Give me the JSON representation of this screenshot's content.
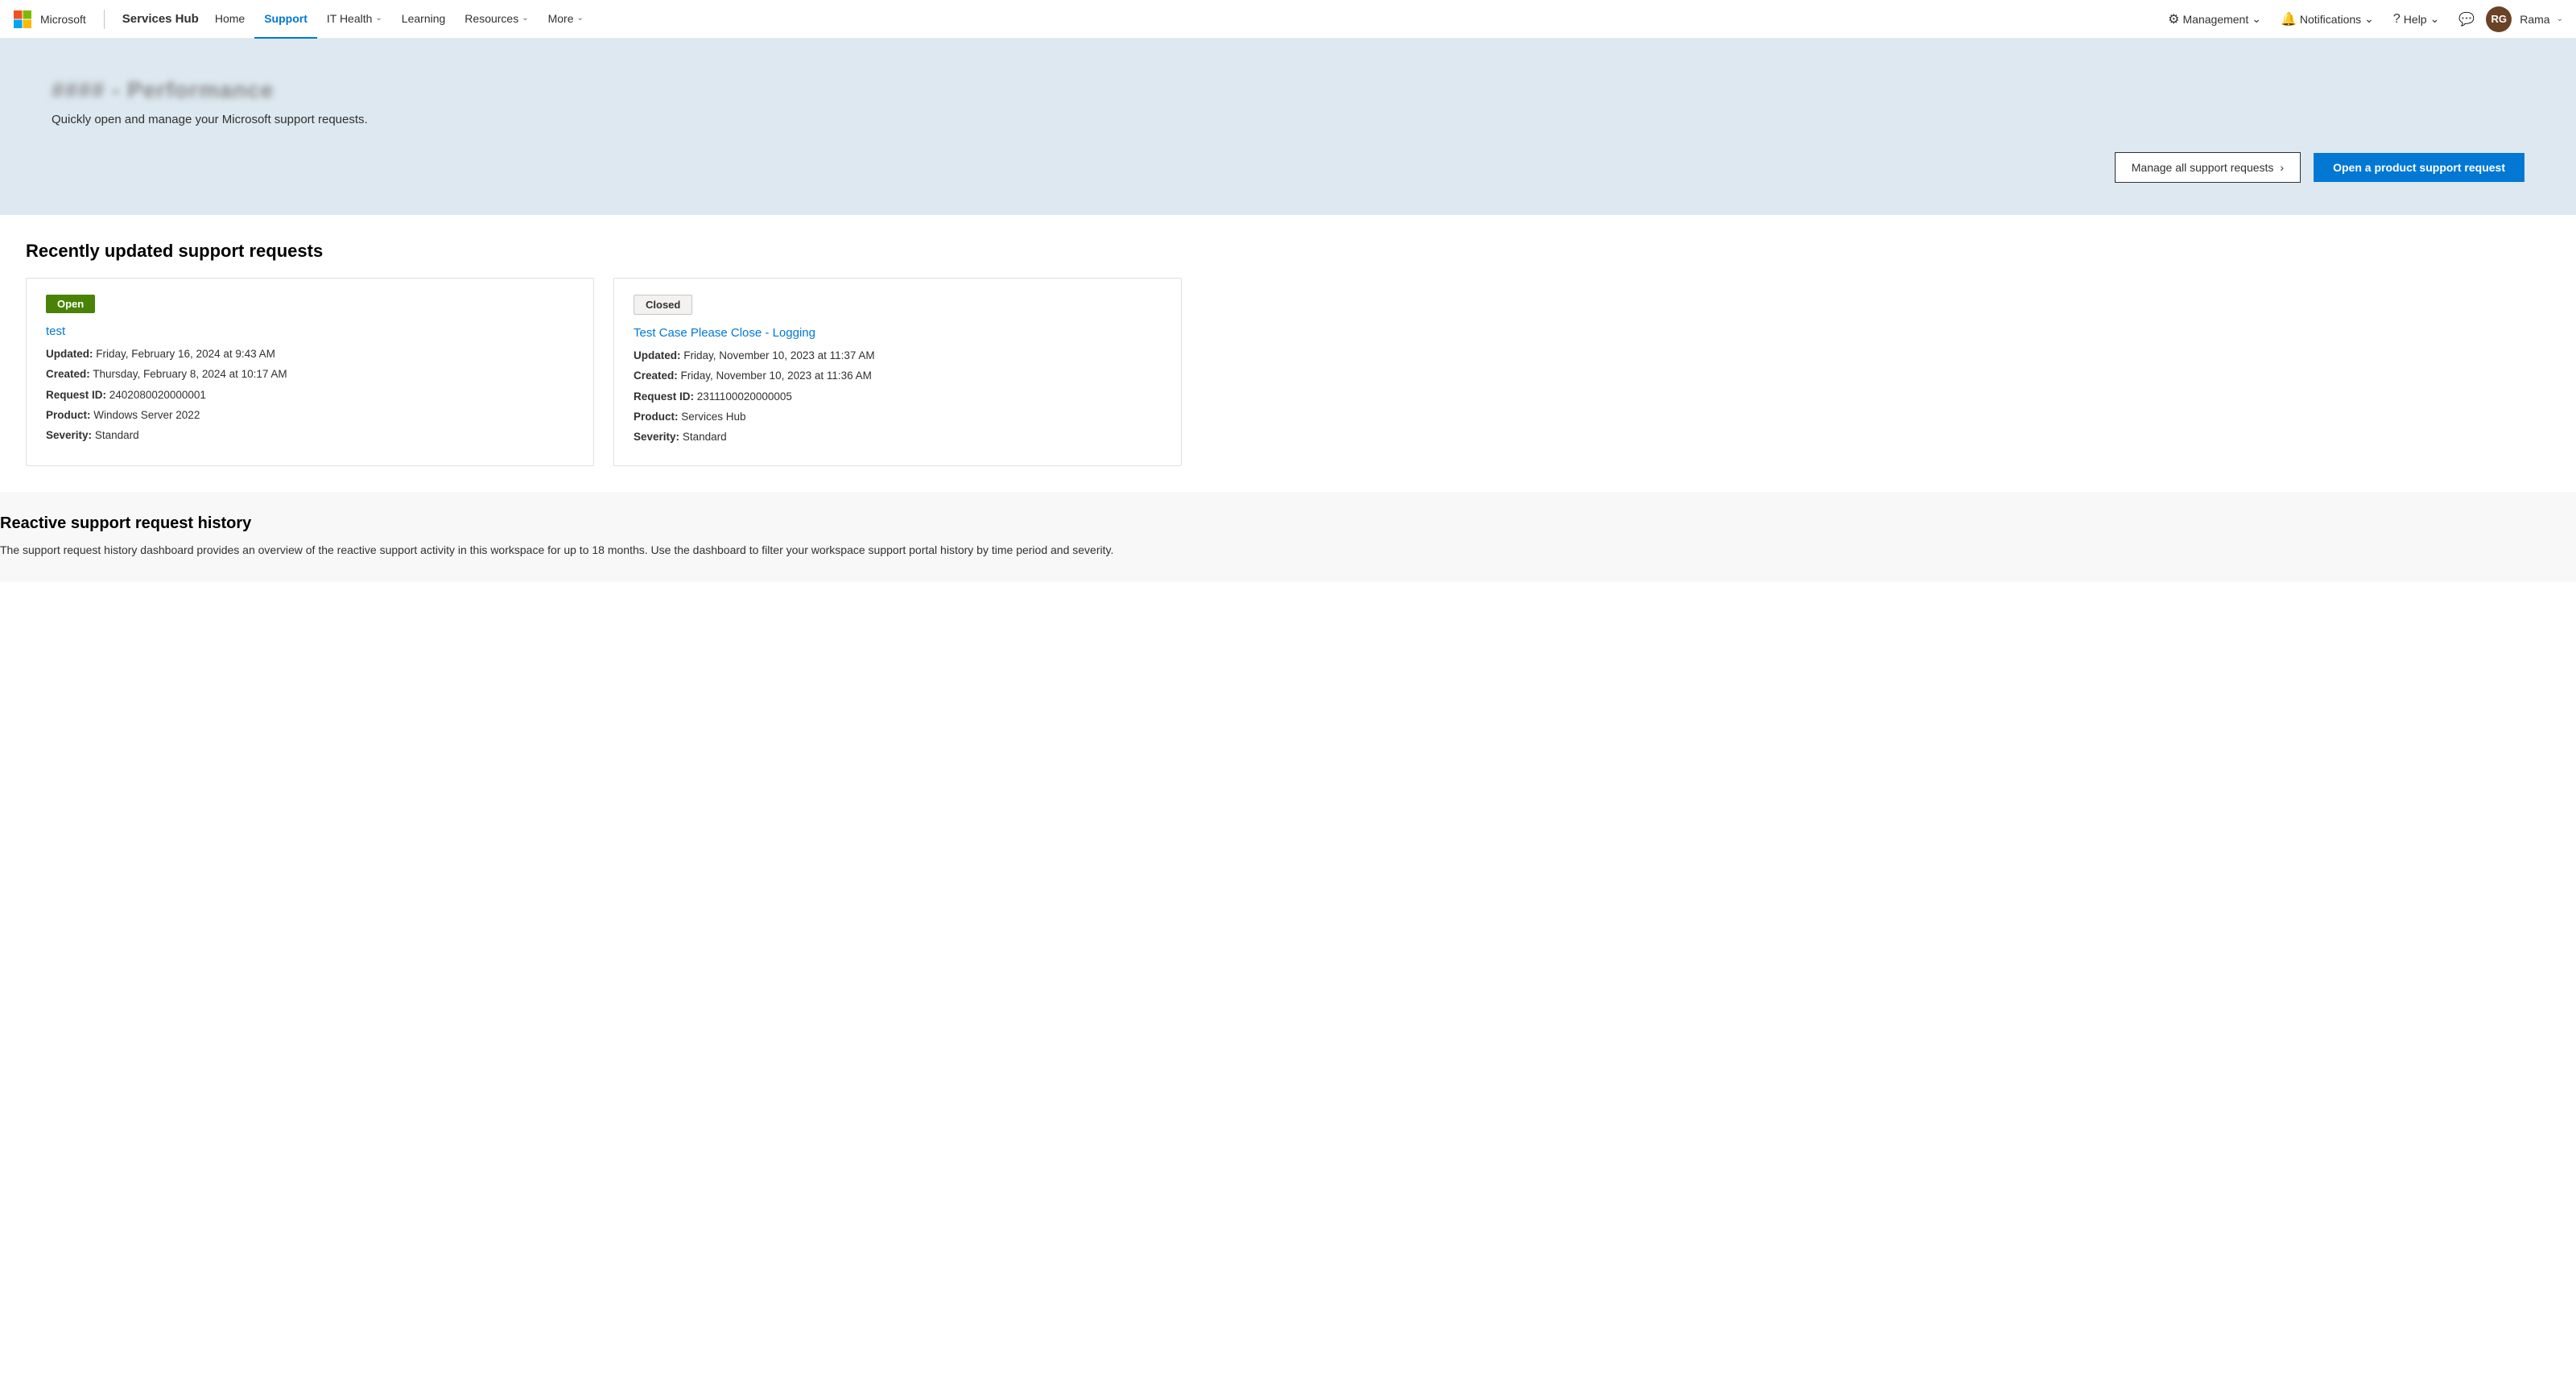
{
  "brand": {
    "app_name": "Services Hub",
    "ms_label": "Microsoft"
  },
  "nav": {
    "home_label": "Home",
    "support_label": "Support",
    "it_health_label": "IT Health",
    "learning_label": "Learning",
    "resources_label": "Resources",
    "more_label": "More",
    "management_label": "Management",
    "notifications_label": "Notifications",
    "help_label": "Help",
    "user_initials": "RG",
    "user_name": "Rama"
  },
  "hero": {
    "title": "#### - Performance",
    "subtitle": "Quickly open and manage your Microsoft support requests.",
    "btn_manage_label": "Manage all support requests",
    "btn_open_label": "Open a product support request"
  },
  "recently_updated": {
    "section_title": "Recently updated support requests",
    "cards": [
      {
        "status": "Open",
        "status_type": "open",
        "case_title": "test",
        "updated": "Updated: Friday, February 16, 2024 at 9:43 AM",
        "created": "Created: Thursday, February 8, 2024 at 10:17 AM",
        "request_id": "Request ID: 2402080020000001",
        "product": "Product: Windows Server 2022",
        "severity": "Severity: Standard"
      },
      {
        "status": "Closed",
        "status_type": "closed",
        "case_title": "Test Case Please Close - Logging",
        "updated": "Updated: Friday, November 10, 2023 at 11:37 AM",
        "created": "Created: Friday, November 10, 2023 at 11:36 AM",
        "request_id": "Request ID: 2311100020000005",
        "product": "Product: Services Hub",
        "severity": "Severity: Standard"
      }
    ]
  },
  "history": {
    "title": "Reactive support request history",
    "description": "The support request history dashboard provides an overview of the reactive support activity in this workspace for up to 18 months. Use the dashboard to filter your workspace support portal history by time period and severity."
  }
}
